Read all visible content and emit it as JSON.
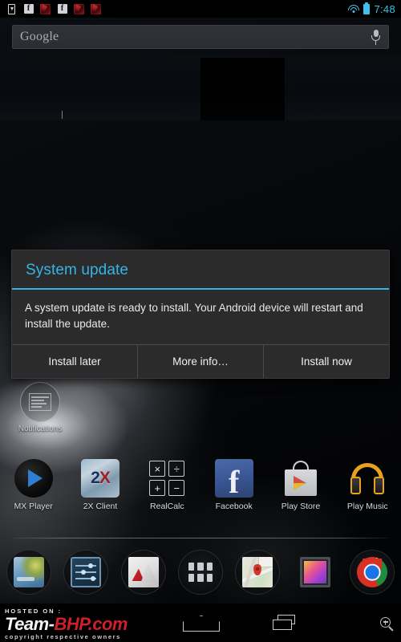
{
  "status_bar": {
    "time": "7:48",
    "accent_color": "#3fc0e8",
    "left_icons": [
      {
        "name": "download-icon",
        "label": "download"
      },
      {
        "name": "facebook-notification-icon",
        "label": "f"
      },
      {
        "name": "app-notification-red-icon",
        "label": ""
      },
      {
        "name": "facebook-notification-icon-2",
        "label": "f"
      },
      {
        "name": "app-notification-red-icon-2",
        "label": ""
      },
      {
        "name": "app-notification-red-icon-3",
        "label": ""
      }
    ],
    "right_icons": [
      {
        "name": "wifi-icon"
      },
      {
        "name": "battery-icon"
      }
    ]
  },
  "search": {
    "text": "Google",
    "placeholder": "Google",
    "mic_icon": "microphone-icon"
  },
  "dialog": {
    "title": "System update",
    "title_color": "#35b5e5",
    "message": "A system update is ready to install. Your Android device will restart and install the update.",
    "buttons": [
      {
        "label": "Install later",
        "name": "install-later-button"
      },
      {
        "label": "More info…",
        "name": "more-info-button"
      },
      {
        "label": "Install now",
        "name": "install-now-button"
      }
    ]
  },
  "widget": {
    "label": "Notifications",
    "icon": "notifications-list-icon"
  },
  "apps": [
    {
      "label": "MX Player",
      "icon": "mx-player-icon"
    },
    {
      "label": "2X Client",
      "icon": "2x-client-icon",
      "glyph_main": "2",
      "glyph_accent": "X"
    },
    {
      "label": "RealCalc",
      "icon": "realcalc-icon",
      "keys": [
        "×",
        "÷",
        "+",
        "−"
      ]
    },
    {
      "label": "Facebook",
      "icon": "facebook-icon",
      "glyph": "f"
    },
    {
      "label": "Play Store",
      "icon": "play-store-icon"
    },
    {
      "label": "Play Music",
      "icon": "play-music-icon"
    }
  ],
  "dock": [
    {
      "name": "dock-item-browser",
      "icon": "browser-earth-icon"
    },
    {
      "name": "dock-item-settings",
      "icon": "settings-sliders-icon"
    },
    {
      "name": "dock-item-gallery-photo",
      "icon": "photo-red-icon"
    },
    {
      "name": "dock-item-app-drawer",
      "icon": "app-drawer-icon"
    },
    {
      "name": "dock-item-maps",
      "icon": "maps-icon"
    },
    {
      "name": "dock-item-gallery",
      "icon": "gallery-icon"
    },
    {
      "name": "dock-item-chrome",
      "icon": "chrome-icon"
    }
  ],
  "watermark": {
    "top": "HOSTED ON :",
    "brand_white": "Team-",
    "brand_red": "BHP",
    "brand_red_dot": ".com",
    "bottom": "copyright respective owners"
  },
  "nav_bar": {
    "home": "home-icon",
    "recents": "recents-icon",
    "zoom": "zoom-in-icon"
  }
}
